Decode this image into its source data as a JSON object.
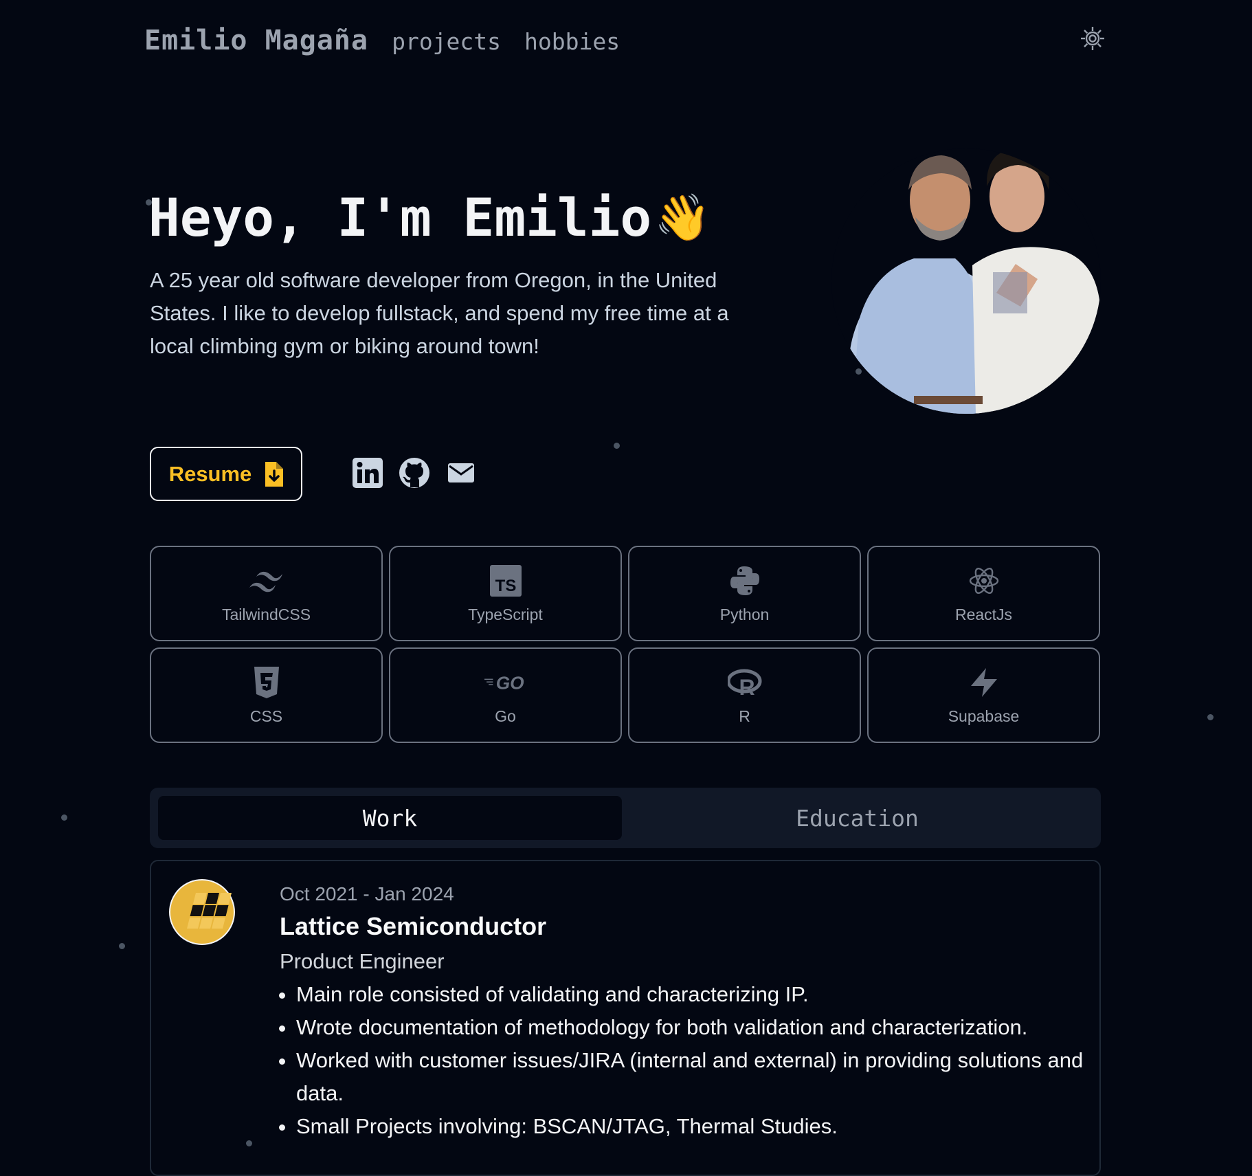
{
  "nav": {
    "brand": "Emilio Magaña",
    "links": [
      "projects",
      "hobbies"
    ],
    "theme_icon": "sun-gear-icon"
  },
  "hero": {
    "greeting": "Heyo, I'm Emilio",
    "wave_emoji": "👋",
    "description": "A 25 year old software developer from Oregon, in the United States. I like to develop fullstack, and spend my free time at a local climbing gym or biking around town!",
    "avatar_icon": "profile-photo"
  },
  "actions": {
    "resume_label": "Resume",
    "resume_icon": "file-download-icon",
    "social_icons": [
      "linkedin-icon",
      "github-icon",
      "mail-icon"
    ]
  },
  "skills": [
    {
      "label": "TailwindCSS",
      "icon": "tailwind-icon"
    },
    {
      "label": "TypeScript",
      "icon": "typescript-icon"
    },
    {
      "label": "Python",
      "icon": "python-icon"
    },
    {
      "label": "ReactJs",
      "icon": "react-icon"
    },
    {
      "label": "CSS",
      "icon": "css3-icon"
    },
    {
      "label": "Go",
      "icon": "go-icon"
    },
    {
      "label": "R",
      "icon": "r-icon"
    },
    {
      "label": "Supabase",
      "icon": "supabase-icon"
    }
  ],
  "tabs": {
    "items": [
      "Work",
      "Education"
    ],
    "active": "Work"
  },
  "experience": {
    "date": "Oct 2021 - Jan 2024",
    "company": "Lattice Semiconductor",
    "role": "Product Engineer",
    "bullets": [
      "Main role consisted of validating and characterizing IP.",
      "Wrote documentation of methodology for both validation and characterization.",
      "Worked with customer issues/JIRA (internal and external) in providing solutions and data.",
      "Small Projects involving: BSCAN/JTAG, Thermal Studies."
    ],
    "logo_icon": "lattice-logo"
  },
  "colors": {
    "background": "#030712",
    "accent": "#fbbf24",
    "muted": "#9ca3af",
    "border": "#6b7280"
  }
}
